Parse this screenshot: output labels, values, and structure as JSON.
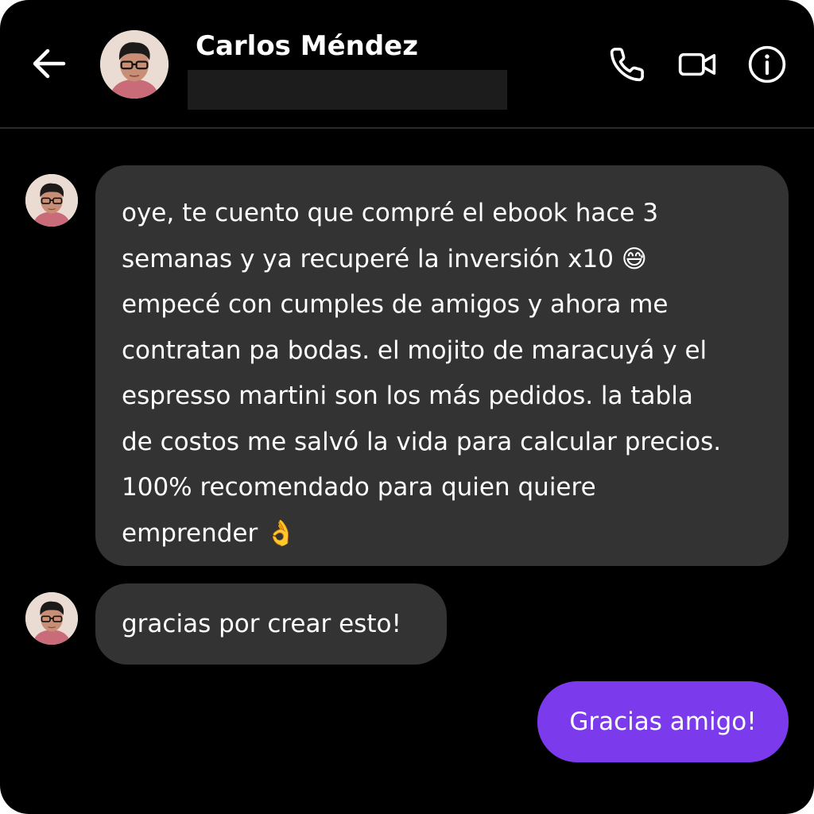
{
  "header": {
    "contact_name": "Carlos Méndez",
    "back_icon": "back-arrow-icon",
    "actions": [
      {
        "name": "voice-call",
        "icon": "phone-icon"
      },
      {
        "name": "video-call",
        "icon": "video-camera-icon"
      },
      {
        "name": "chat-info",
        "icon": "info-icon"
      }
    ]
  },
  "messages": [
    {
      "direction": "incoming",
      "lines": [
        "oye, te cuento que compré el ebook hace 3",
        "semanas y ya recuperé la inversión x10 😅",
        "empecé con cumples de amigos y ahora me",
        "contratan pa bodas. el mojito de maracuyá y el",
        "espresso martini son los más pedidos. la tabla",
        "de costos me salvó la vida para calcular precios.",
        "100% recomendado para quien quiere",
        "emprender 👌"
      ]
    },
    {
      "direction": "incoming",
      "text": "gracias por crear esto!"
    },
    {
      "direction": "outgoing",
      "text": "Gracias amigo!"
    }
  ],
  "colors": {
    "background": "#000000",
    "incoming_bubble": "#333333",
    "outgoing_bubble": "#7c3aed",
    "text": "#ffffff"
  }
}
